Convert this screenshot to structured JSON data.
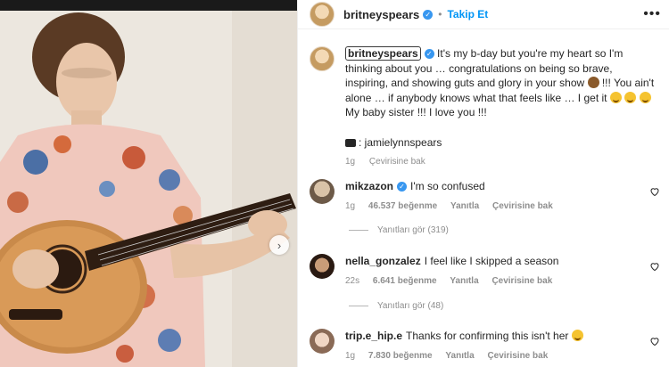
{
  "post": {
    "username": "britneyspears",
    "follow_label": "Takip Et",
    "separator": "•",
    "more_label": "•••"
  },
  "caption": {
    "username": "britneyspears",
    "text_1": "It's my b-day but you're my heart so I'm thinking about you … congratulations on being so brave, inspiring, and showing guts and glory in your show",
    "text_2": "!!! You ain't alone … if anybody knows what that feels like … I get it",
    "text_3": "My baby sister !!! I love you !!!",
    "credit": "jamielynnspears",
    "time": "1g",
    "translate": "Çevirisine bak"
  },
  "comments": [
    {
      "username": "mikzazon",
      "verified": true,
      "text": "I'm so confused",
      "time": "1g",
      "likes": "46.537 beğenme",
      "reply": "Yanıtla",
      "translate": "Çevirisine bak",
      "view_replies": "Yanıtları gör (319)"
    },
    {
      "username": "nella_gonzalez",
      "verified": false,
      "text": "I feel like I skipped a season",
      "time": "22s",
      "likes": "6.641 beğenme",
      "reply": "Yanıtla",
      "translate": "Çevirisine bak",
      "view_replies": "Yanıtları gör (48)"
    },
    {
      "username": "trip.e_hip.e",
      "verified": false,
      "text": "Thanks for confirming this isn't her",
      "time": "1g",
      "likes": "7.830 beğenme",
      "reply": "Yanıtla",
      "translate": "Çevirisine bak"
    }
  ],
  "colors": {
    "accent": "#0095f6",
    "verified": "#3897f0",
    "muted": "#8e8e8e"
  },
  "icons": {
    "more": "more-dots-icon",
    "heart": "heart-outline-icon",
    "next": "chevron-right-icon",
    "camera": "camera-icon"
  }
}
